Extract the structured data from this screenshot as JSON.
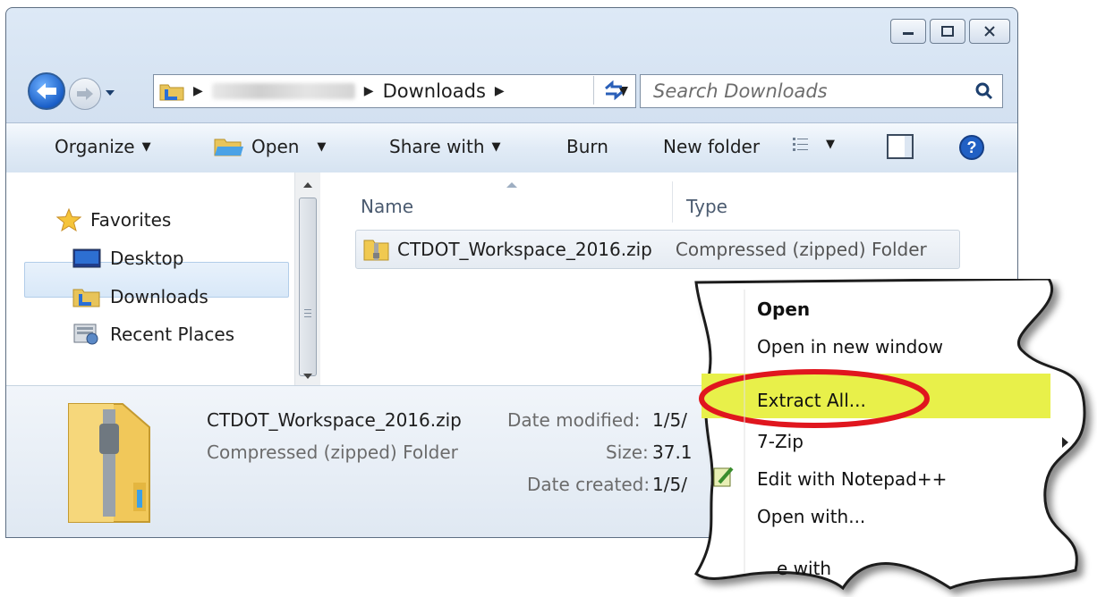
{
  "nav": {
    "address": {
      "crumb": "Downloads"
    },
    "search_placeholder": "Search Downloads"
  },
  "toolbar": {
    "organize": "Organize",
    "open": "Open",
    "share_with": "Share with",
    "burn": "Burn",
    "new_folder": "New folder"
  },
  "sidebar": {
    "favorites": "Favorites",
    "items": [
      {
        "label": "Desktop"
      },
      {
        "label": "Downloads"
      },
      {
        "label": "Recent Places"
      }
    ]
  },
  "files": {
    "columns": [
      "Name",
      "Type"
    ],
    "rows": [
      {
        "name": "CTDOT_Workspace_2016.zip",
        "type": "Compressed (zipped) Folder"
      }
    ]
  },
  "details": {
    "filename": "CTDOT_Workspace_2016.zip",
    "filetype": "Compressed (zipped) Folder",
    "date_modified_label": "Date modified:",
    "date_modified_value": "1/5/",
    "size_label": "Size:",
    "size_value": "37.1",
    "date_created_label": "Date created:",
    "date_created_value": "1/5/"
  },
  "context_menu": {
    "items": [
      "Open",
      "Open in new window",
      "Extract All...",
      "7-Zip",
      "Edit with Notepad++",
      "Open with...",
      "e with"
    ],
    "highlight_color": "#e8f04a",
    "circle_color": "#e0161e"
  }
}
